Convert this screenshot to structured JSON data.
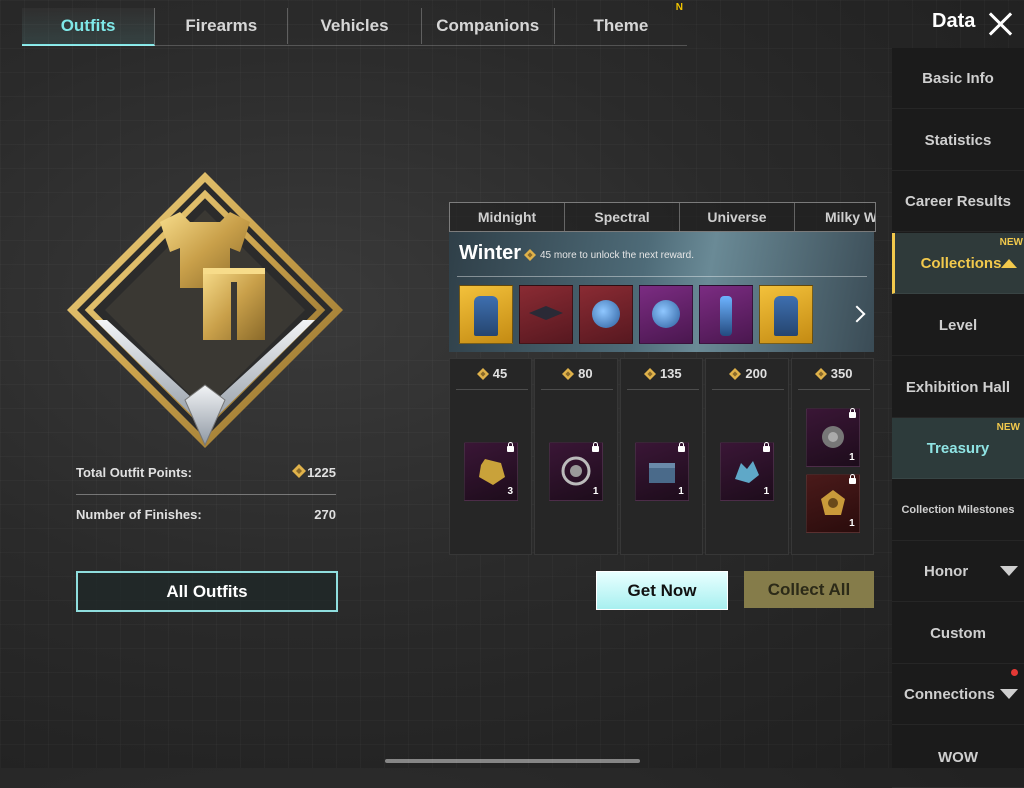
{
  "top_tabs": [
    {
      "label": "Outfits",
      "active": true
    },
    {
      "label": "Firearms",
      "active": false
    },
    {
      "label": "Vehicles",
      "active": false
    },
    {
      "label": "Companions",
      "active": false
    },
    {
      "label": "Theme",
      "active": false,
      "badge": "N"
    }
  ],
  "header": {
    "title": "Data"
  },
  "sidebar": {
    "items": [
      {
        "label": "Basic Info"
      },
      {
        "label": "Statistics"
      },
      {
        "label": "Career Results"
      },
      {
        "label": "Collections",
        "badge": "NEW",
        "state": "active-expanded"
      },
      {
        "label": "Level"
      },
      {
        "label": "Exhibition Hall"
      },
      {
        "label": "Treasury",
        "badge": "NEW",
        "state": "selected"
      },
      {
        "label": "Collection Milestones"
      },
      {
        "label": "Honor",
        "state": "collapsed"
      },
      {
        "label": "Custom"
      },
      {
        "label": "Connections",
        "state": "collapsed",
        "notification_dot": true
      },
      {
        "label": "WOW"
      }
    ]
  },
  "stats": {
    "total_outfit_points_label": "Total Outfit Points:",
    "total_outfit_points_value": "1225",
    "finishes_label": "Number of Finishes:",
    "finishes_value": "270"
  },
  "buttons": {
    "all_outfits": "All Outfits",
    "get_now": "Get Now",
    "collect_all": "Collect All"
  },
  "collection_tabs": [
    "Midnight",
    "Spectral",
    "Universe",
    "Milky Wa"
  ],
  "banner": {
    "title": "Winter",
    "subtitle": "45 more to unlock the next reward."
  },
  "rewards": [
    {
      "cost": "45",
      "items": [
        {
          "qty": "3"
        }
      ]
    },
    {
      "cost": "80",
      "items": [
        {
          "qty": "1"
        }
      ]
    },
    {
      "cost": "135",
      "items": [
        {
          "qty": "1"
        }
      ]
    },
    {
      "cost": "200",
      "items": [
        {
          "qty": "1"
        }
      ]
    },
    {
      "cost": "350",
      "items": [
        {
          "qty": "1"
        },
        {
          "qty": "1"
        }
      ]
    }
  ],
  "colors": {
    "accent_cyan": "#7fe8e8",
    "gold": "#f2c94c",
    "background": "#2a2a2a"
  }
}
